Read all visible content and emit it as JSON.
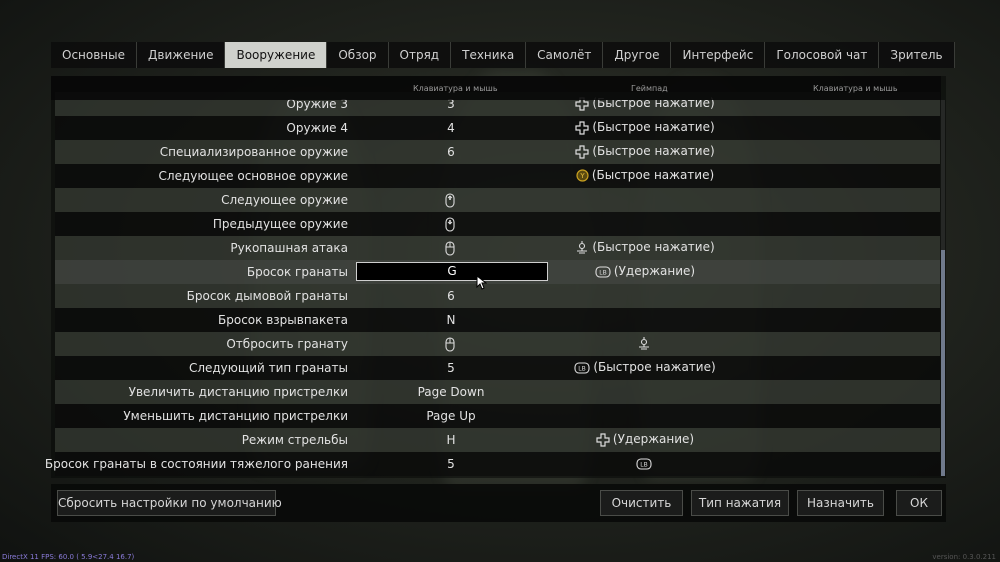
{
  "tabs": [
    "Основные",
    "Движение",
    "Вооружение",
    "Обзор",
    "Отряд",
    "Техника",
    "Самолёт",
    "Другое",
    "Интерфейс",
    "Голосовой чат",
    "Зритель"
  ],
  "active_tab": "Вооружение",
  "columns": {
    "keyboard": "Клавиатура и мышь",
    "gamepad": "Геймпад",
    "keyboard2": "Клавиатура и мышь"
  },
  "rows": [
    {
      "name": "Оружие 3",
      "kb": "3",
      "gp_icon": "dpad-icon",
      "gp": "(Быстрое нажатие)"
    },
    {
      "name": "Оружие 4",
      "kb": "4",
      "gp_icon": "dpad-icon",
      "gp": "(Быстрое нажатие)"
    },
    {
      "name": "Специализированное оружие",
      "kb": "6",
      "gp_icon": "dpad-icon",
      "gp": "(Быстрое нажатие)"
    },
    {
      "name": "Следующее основное оружие",
      "kb": "",
      "gp_icon": "y-button-icon",
      "gp": "(Быстрое нажатие)"
    },
    {
      "name": "Следующее оружие",
      "kb": "",
      "kb_icon": "mouse-wheel-up-icon",
      "gp_icon": "",
      "gp": ""
    },
    {
      "name": "Предыдущее оружие",
      "kb": "",
      "kb_icon": "mouse-wheel-down-icon",
      "gp_icon": "",
      "gp": ""
    },
    {
      "name": "Рукопашная атака",
      "kb": "",
      "kb_icon": "mouse-button-icon",
      "gp_icon": "right-stick-icon",
      "gp": "(Быстрое нажатие)"
    },
    {
      "name": "Бросок гранаты",
      "kb": "G",
      "gp_icon": "lb-icon",
      "gp": "(Удержание)"
    },
    {
      "name": "Бросок дымовой гранаты",
      "kb": "6",
      "gp_icon": "",
      "gp": ""
    },
    {
      "name": "Бросок взрывпакета",
      "kb": "N",
      "gp_icon": "",
      "gp": ""
    },
    {
      "name": "Отбросить гранату",
      "kb": "",
      "kb_icon": "mouse-button-icon",
      "gp_icon": "right-stick-icon",
      "gp": ""
    },
    {
      "name": "Следующий тип гранаты",
      "kb": "5",
      "gp_icon": "lb-icon",
      "gp": "(Быстрое нажатие)"
    },
    {
      "name": "Увеличить дистанцию пристрелки",
      "kb": "Page Down",
      "gp_icon": "",
      "gp": ""
    },
    {
      "name": "Уменьшить дистанцию пристрелки",
      "kb": "Page Up",
      "gp_icon": "",
      "gp": ""
    },
    {
      "name": "Режим стрельбы",
      "kb": "H",
      "gp_icon": "dpad-icon",
      "gp": "(Удержание)"
    },
    {
      "name": "Бросок гранаты в состоянии тяжелого ранения",
      "kb": "5",
      "gp_icon": "lb-icon",
      "gp": ""
    }
  ],
  "footer": {
    "reset": "Сбросить настройки по умолчанию",
    "clear": "Очистить",
    "press_type": "Тип нажатия",
    "assign": "Назначить",
    "ok": "ОК"
  },
  "status": "DirectX 11 FPS: 60.0 ( 5.9<27.4 16.7)",
  "version": "version: 0.3.0.211",
  "colors": {
    "tab_active": "#cfd1cc",
    "scroll_thumb": "#707a8c",
    "y_button": "#c8a020",
    "status_text": "#8a7bd9"
  }
}
